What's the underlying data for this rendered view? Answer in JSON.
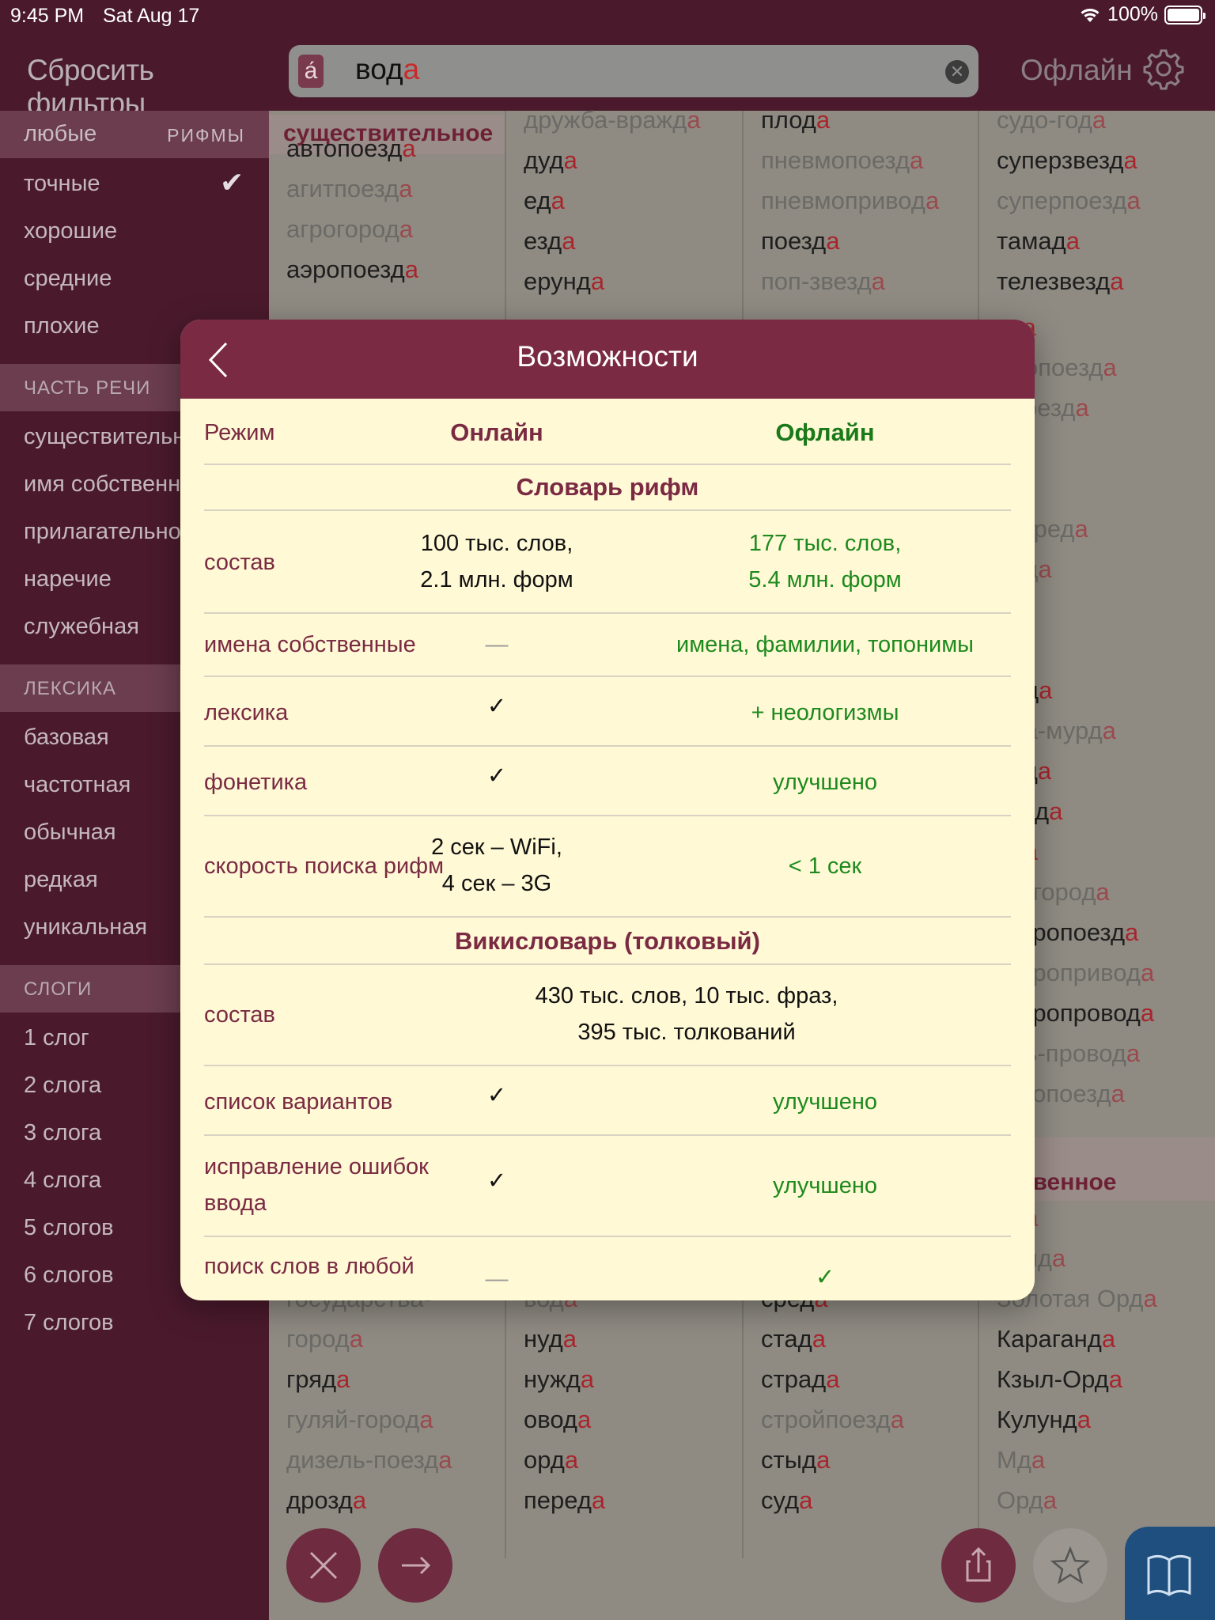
{
  "status": {
    "time": "9:45 PM",
    "date": "Sat Aug 17",
    "battery": "100%"
  },
  "header": {
    "reset_filters": "Сбросить фильтры",
    "search_value": "вод",
    "search_value_rhyme": "а",
    "accent_button": "а́",
    "offline": "Офлайн"
  },
  "sidebar": {
    "rhymes_any": "любые",
    "rhymes_header": "РИФМЫ",
    "rhyme_items": [
      "точные",
      "хорошие",
      "средние",
      "плохие"
    ],
    "pos_header": "ЧАСТЬ РЕЧИ",
    "pos_items": [
      "существительное",
      "имя собственное",
      "прилагательное",
      "наречие",
      "служебная"
    ],
    "lex_header": "ЛЕКСИКА",
    "lex_items": [
      "базовая",
      "частотная",
      "обычная",
      "редкая",
      "уникальная"
    ],
    "syl_header": "СЛОГИ",
    "syl_items": [
      "1 слог",
      "2 слога",
      "3 слога",
      "4 слога",
      "5 слогов",
      "6 слогов",
      "7 слогов"
    ]
  },
  "results": {
    "cat_noun": "существительное",
    "cat_proper_1": "я",
    "cat_proper_2": "бственное",
    "col1_top": [
      [
        "автопоезд",
        "a",
        ""
      ],
      [
        "агитпоезд",
        "a",
        "g"
      ],
      [
        "агрогород",
        "a",
        "g"
      ],
      [
        "аэропоезд",
        "a",
        ""
      ]
    ],
    "col1_bottom": [
      [
        "государства-",
        "",
        "g"
      ],
      [
        "город",
        "a",
        "g"
      ],
      [
        "гряд",
        "a",
        ""
      ],
      [
        "гуляй-город",
        "a",
        "g"
      ],
      [
        "дизель-поезд",
        "a",
        "g"
      ],
      [
        "дрозд",
        "a",
        ""
      ]
    ],
    "col2_top": [
      [
        "дружба-вражд",
        "a",
        "g"
      ],
      [
        "дуд",
        "a",
        ""
      ],
      [
        "ед",
        "a",
        ""
      ],
      [
        "езд",
        "a",
        ""
      ],
      [
        "ерунд",
        "a",
        ""
      ]
    ],
    "col2_bottom": [
      [
        "вод",
        "a",
        "g"
      ],
      [
        "нуд",
        "a",
        ""
      ],
      [
        "нужд",
        "a",
        ""
      ],
      [
        "овод",
        "a",
        ""
      ],
      [
        "орд",
        "a",
        ""
      ],
      [
        "перед",
        "a",
        ""
      ]
    ],
    "col3_top": [
      [
        "плод",
        "a",
        ""
      ],
      [
        "пневмопоезд",
        "a",
        "g"
      ],
      [
        "пневмопривод",
        "a",
        "g"
      ],
      [
        "поезд",
        "a",
        ""
      ],
      [
        "поп-звезд",
        "a",
        "g"
      ]
    ],
    "col3_bottom": [
      [
        "сред",
        "a",
        ""
      ],
      [
        "стад",
        "a",
        ""
      ],
      [
        "страд",
        "a",
        ""
      ],
      [
        "стройпоезд",
        "a",
        "g"
      ],
      [
        "стыд",
        "a",
        ""
      ],
      [
        "суд",
        "a",
        ""
      ]
    ],
    "col4_top": [
      [
        "судо-год",
        "a",
        "g"
      ],
      [
        "суперзвезд",
        "a",
        ""
      ],
      [
        "суперпоезд",
        "a",
        "g"
      ],
      [
        "тамад",
        "a",
        ""
      ],
      [
        "телезвезд",
        "a",
        ""
      ]
    ],
    "col4_peek": [
      [
        "уд",
        "a",
        ""
      ],
      [
        "обопоезд",
        "a",
        "g"
      ],
      [
        "опоезд",
        "a",
        "g"
      ],
      [
        "",
        "a",
        ""
      ],
      [
        "д",
        "a",
        ""
      ],
      [
        "тосред",
        "a",
        "g"
      ],
      [
        "енд",
        "a",
        "g"
      ],
      [
        "д",
        "a",
        "g"
      ],
      [
        "д",
        "a",
        ""
      ],
      [
        "лод",
        "a",
        ""
      ],
      [
        "рда-мурд",
        "a",
        "g"
      ],
      [
        "ред",
        "a",
        ""
      ],
      [
        "кард",
        "a",
        ""
      ],
      [
        "ед",
        "a",
        ""
      ],
      [
        "до-город",
        "a",
        "g"
      ],
      [
        "ектропоезд",
        "a",
        ""
      ],
      [
        "ектропривод",
        "a",
        "g"
      ],
      [
        "ектропровод",
        "a",
        ""
      ],
      [
        "аль-провод",
        "a",
        "g"
      ],
      [
        "ергопоезд",
        "a",
        "g"
      ]
    ],
    "col4_bottom": [
      [
        "нд",
        "a",
        "g"
      ],
      [
        "орид",
        "a",
        "g"
      ],
      [
        "Золотая Орд",
        "a",
        "g"
      ],
      [
        "Караганд",
        "a",
        ""
      ],
      [
        "Кзыл-Орд",
        "a",
        ""
      ],
      [
        "Кулунд",
        "a",
        ""
      ],
      [
        "Мд",
        "a",
        "g"
      ],
      [
        "Орд",
        "a",
        "g"
      ]
    ]
  },
  "modal": {
    "title": "Возможности",
    "mode_label": "Режим",
    "online": "Онлайн",
    "offline": "Офлайн",
    "section_rhymes": "Словарь рифм",
    "section_wiki": "Викисловарь (толковый)",
    "rows": {
      "composition_label": "состав",
      "composition_online_1": "100 тыс. слов,",
      "composition_online_2": "2.1 млн. форм",
      "composition_offline_1": "177 тыс. слов,",
      "composition_offline_2": "5.4 млн. форм",
      "proper_label": "имена собственные",
      "proper_online": "—",
      "proper_offline": "имена, фамилии, топонимы",
      "lexicon_label": "лексика",
      "lexicon_online": "✓",
      "lexicon_offline": "+ неологизмы",
      "phonetics_label": "фонетика",
      "phonetics_online": "✓",
      "phonetics_offline": "улучшено",
      "speed_label": "скорость поиска рифм",
      "speed_online_1": "2 сек – WiFi,",
      "speed_online_2": "4 сек – 3G",
      "speed_offline": "< 1 сек",
      "wiki_comp_label": "состав",
      "wiki_comp_1": "430 тыс. слов, 10 тыс. фраз,",
      "wiki_comp_2": "395 тыс. толкований",
      "variants_label": "список вариантов",
      "variants_online": "✓",
      "variants_offline": "улучшено",
      "typo_label_1": "исправление ошибок",
      "typo_label_2": "ввода",
      "typo_online": "✓",
      "typo_offline": "улучшено",
      "search_any_label": "поиск слов в любой",
      "search_any_online": "—",
      "search_any_offline": "✓"
    }
  }
}
